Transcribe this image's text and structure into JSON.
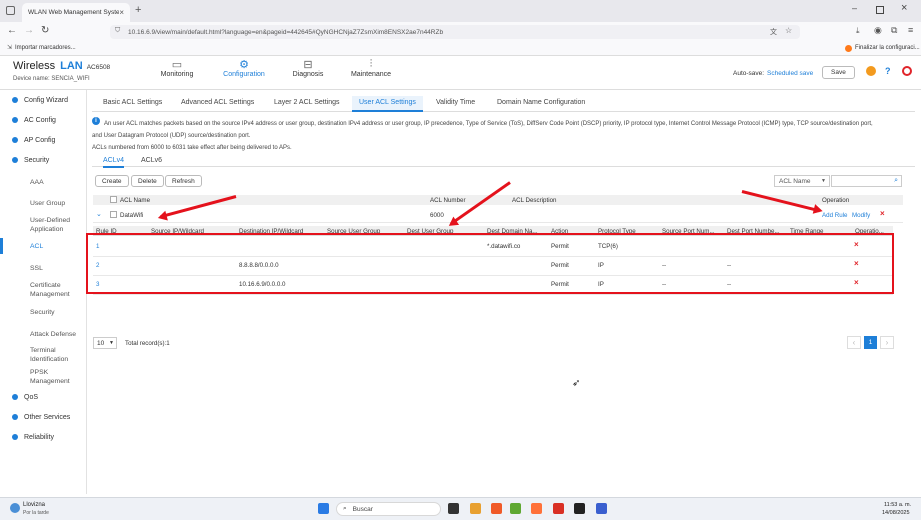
{
  "browser": {
    "tab_title": "WLAN Web Management System",
    "url": "10.16.6.9/view/main/default.html?language=en&pageid=442645#QyNGHCNjaZ7ZsmXim8ENSX2ae7n44RZb",
    "bookmark_import": "Importar marcadores...",
    "bookmark_config": "Finalizar la configuraci..."
  },
  "header": {
    "brand_wireless": "Wireless",
    "brand_lan": "LAN",
    "model": "AC6508",
    "device_name": "Device name:  SENCIA_WIFI",
    "nav": [
      "Monitoring",
      "Configuration",
      "Diagnosis",
      "Maintenance"
    ],
    "autosave_label": "Auto-save:",
    "autosave_link": "Scheduled save",
    "save_button": "Save"
  },
  "sidebar": {
    "top_items": [
      "Config Wizard",
      "AC Config",
      "AP Config",
      "Security"
    ],
    "security_items": [
      "AAA",
      "User Group",
      "User-Defined Application",
      "ACL",
      "SSL",
      "Certificate Management",
      "Security",
      "Attack Defense",
      "Terminal Identification",
      "PPSK Management"
    ],
    "bottom_items": [
      "QoS",
      "Other Services",
      "Reliability"
    ]
  },
  "subtabs": [
    "Basic ACL Settings",
    "Advanced ACL Settings",
    "Layer 2 ACL Settings",
    "User ACL Settings",
    "Validity Time",
    "Domain Name Configuration"
  ],
  "info": {
    "line1": "An user ACL matches packets based on the source IPv4 address or user group, destination IPv4 address or user group, IP precedence, Type of Service (ToS), DiffServ Code Point (DSCP) priority, IP protocol type, Internet Control Message Protocol (ICMP) type, TCP source/destination port,",
    "line2": "and User Datagram Protocol (UDP) source/destination port.",
    "line3": "ACLs numbered from 6000 to 6031 take effect after being delivered to APs."
  },
  "acl_tabs": [
    "ACLv4",
    "ACLv6"
  ],
  "toolbar": {
    "create": "Create",
    "delete": "Delete",
    "refresh": "Refresh",
    "filter_select": "ACL Name"
  },
  "acl_table": {
    "headers": [
      "ACL Name",
      "ACL Number",
      "ACL Description",
      "Operation"
    ],
    "row": {
      "name": "DataWifi",
      "number": "6000",
      "description": ""
    },
    "operations": [
      "Add Rule",
      "Modify"
    ]
  },
  "rule_table": {
    "headers": [
      "Rule ID",
      "Source IP/Wildcard",
      "Destination IP/Wildcard",
      "Source User Group",
      "Dest User Group",
      "Dest Domain Na...",
      "Action",
      "Protocol Type",
      "Source Port Num...",
      "Dest Port Numbe...",
      "Time Range",
      "Operatio..."
    ],
    "rows": [
      {
        "id": "1",
        "src_ip": "",
        "dst_ip": "",
        "src_group": "",
        "dst_group": "",
        "domain": "*.datawifi.co",
        "action": "Permit",
        "protocol": "TCP(6)",
        "src_port": "",
        "dst_port": ""
      },
      {
        "id": "2",
        "src_ip": "",
        "dst_ip": "8.8.8.8/0.0.0.0",
        "src_group": "",
        "dst_group": "",
        "domain": "",
        "action": "Permit",
        "protocol": "IP",
        "src_port": "--",
        "dst_port": "--"
      },
      {
        "id": "3",
        "src_ip": "",
        "dst_ip": "10.16.6.9/0.0.0.0",
        "src_group": "",
        "dst_group": "",
        "domain": "",
        "action": "Permit",
        "protocol": "IP",
        "src_port": "--",
        "dst_port": "--"
      }
    ]
  },
  "pagination": {
    "page_size": "10",
    "total": "Total record(s):1",
    "current_page": "1"
  },
  "taskbar": {
    "weather_title": "Llovizna",
    "weather_sub": "Por la tarde",
    "search": "Buscar",
    "time": "11:53 a. m.",
    "date": "14/08/2025"
  },
  "colors": {
    "accent": "#1e7fd8",
    "annotation_red": "#e4121c"
  }
}
